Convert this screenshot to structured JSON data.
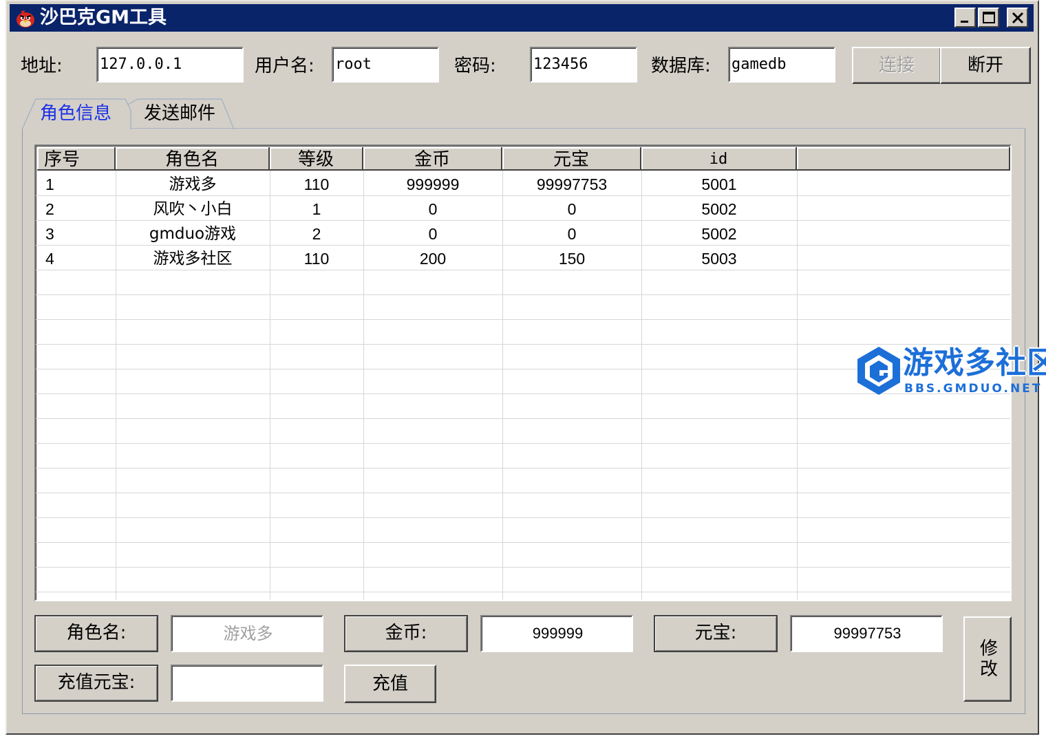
{
  "window": {
    "title": "沙巴克GM工具",
    "controls": {
      "minimize": "_",
      "maximize": "□",
      "close": "×"
    }
  },
  "connection": {
    "address_label": "地址:",
    "address_value": "127.0.0.1",
    "username_label": "用户名:",
    "username_value": "root",
    "password_label": "密码:",
    "password_value": "123456",
    "database_label": "数据库:",
    "database_value": "gamedb",
    "connect_label": "连接",
    "disconnect_label": "断开"
  },
  "tabs": [
    {
      "label": "角色信息",
      "active": true
    },
    {
      "label": "发送邮件",
      "active": false
    }
  ],
  "table": {
    "columns": [
      "序号",
      "角色名",
      "等级",
      "金币",
      "元宝",
      "id",
      ""
    ],
    "rows": [
      [
        "1",
        "游戏多",
        "110",
        "999999",
        "99997753",
        "5001"
      ],
      [
        "2",
        "风吹丶小白",
        "1",
        "0",
        "0",
        "5002"
      ],
      [
        "3",
        "gmduo游戏",
        "2",
        "0",
        "0",
        "5002"
      ],
      [
        "4",
        "游戏多社区",
        "110",
        "200",
        "150",
        "5003"
      ]
    ]
  },
  "editor": {
    "role_name_label": "角色名:",
    "role_name_value": "游戏多",
    "gold_label": "金币:",
    "gold_value": "999999",
    "yuanbao_label": "元宝:",
    "yuanbao_value": "99997753",
    "recharge_label": "充值元宝:",
    "recharge_value": "",
    "recharge_button": "充值",
    "modify_button": "修改"
  },
  "watermark": {
    "title": "游戏多社区",
    "subtitle": "BBS.GMDUO.NET"
  },
  "colors": {
    "titlebar": "#0a246a",
    "face": "#d4d0c8",
    "active_tab_text": "#1a2ee8",
    "watermark": "#1d6fd8"
  }
}
